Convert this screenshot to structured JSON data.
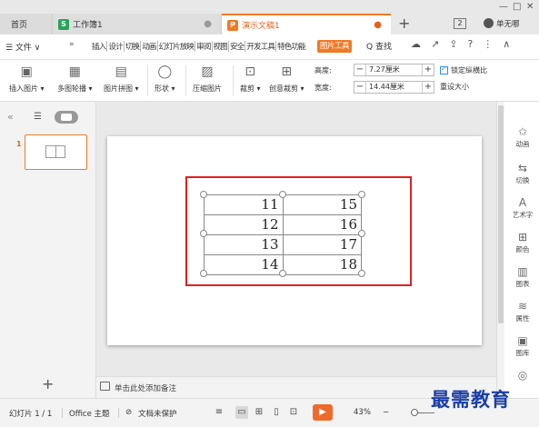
{
  "tabs": {
    "home": "首页",
    "workbook": "工作簿1",
    "presentation": "演示文稿1",
    "new_tab": "+",
    "wb_icon": "S",
    "ppt_icon": "P",
    "modified_dot": "●"
  },
  "window": {
    "minimize": "—",
    "maximize": "□",
    "close": "✕",
    "window_count": "2",
    "user_name": "单无哪"
  },
  "menubar": {
    "file": "☰ 文件 ∨",
    "more": "»",
    "tabs": [
      "插入",
      "设计",
      "切换",
      "动画",
      "幻灯片放映",
      "审阅",
      "视图",
      "安全",
      "开发工具",
      "特色功能"
    ],
    "active_tab": "图片工具",
    "search": "Q 查找",
    "right_icons": [
      "☁",
      "↗",
      "⇪",
      "?",
      "⋮",
      "∧"
    ]
  },
  "ribbon": {
    "buttons": [
      {
        "icon": "▣",
        "label": "插入图片 ▾"
      },
      {
        "icon": "▦",
        "label": "多图轮播 ▾"
      },
      {
        "icon": "▤",
        "label": "图片拼图 ▾"
      },
      {
        "icon": "◯",
        "label": "形状 ▾"
      },
      {
        "icon": "▨",
        "label": "压缩图片"
      },
      {
        "icon": "⊡",
        "label": "裁剪 ▾"
      },
      {
        "icon": "⊞",
        "label": "创意裁剪 ▾"
      }
    ],
    "height_label": "高度:",
    "height_value": "7.27厘米",
    "width_label": "宽度:",
    "width_value": "14.44厘米",
    "minus": "−",
    "plus": "+",
    "lock_ratio": "锁定纵横比",
    "reset_size": "重设大小"
  },
  "left_panel": {
    "slide_number": "1",
    "add": "+"
  },
  "table": {
    "rows": [
      [
        "11",
        "15"
      ],
      [
        "12",
        "16"
      ],
      [
        "13",
        "17"
      ],
      [
        "14",
        "18"
      ]
    ]
  },
  "notes": {
    "placeholder": "单击此处添加备注"
  },
  "right_panel": {
    "items": [
      {
        "icon": "✩",
        "label": "动画"
      },
      {
        "icon": "⇆",
        "label": "切换"
      },
      {
        "icon": "A",
        "label": "艺术字"
      },
      {
        "icon": "⊞",
        "label": "颜色"
      },
      {
        "icon": "▥",
        "label": "图表"
      },
      {
        "icon": "≋",
        "label": "属性"
      },
      {
        "icon": "▣",
        "label": "图库"
      },
      {
        "icon": "◎",
        "label": ""
      }
    ]
  },
  "status": {
    "slide_count": "幻灯片 1 / 1",
    "theme": "Office 主题",
    "protection": "文档未保护",
    "zoom": "43%",
    "zoom_minus": "−",
    "watermark": "最需教育"
  },
  "colors": {
    "accent": "#f07a26",
    "selection": "#e02020",
    "watermark": "#1a3ea8"
  }
}
